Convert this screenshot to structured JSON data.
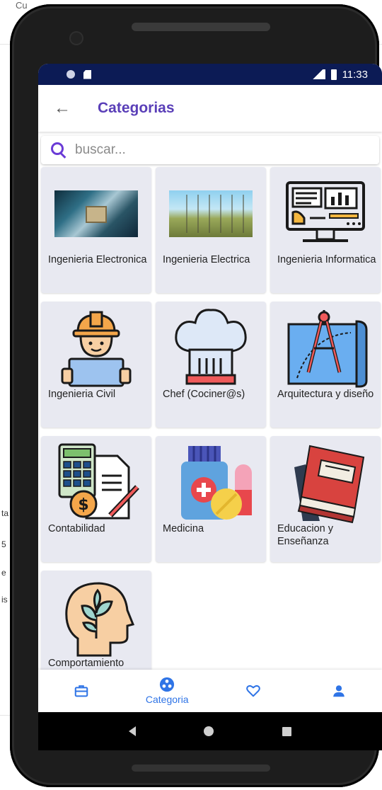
{
  "background": {
    "top_text": "Cu",
    "left_fragments": [
      "ta",
      "5",
      "e",
      "is"
    ]
  },
  "statusbar": {
    "time": "11:33"
  },
  "appbar": {
    "title": "Categorias",
    "back_icon": "arrow-left-icon"
  },
  "search": {
    "placeholder": "buscar...",
    "value": ""
  },
  "categories": [
    {
      "label": "Ingenieria Electronica",
      "icon": "circuit-board-photo"
    },
    {
      "label": "Ingenieria Electrica",
      "icon": "power-lines-photo"
    },
    {
      "label": "Ingenieria Informatica",
      "icon": "computer-dashboard-icon"
    },
    {
      "label": "Ingenieria Civil",
      "icon": "construction-worker-icon"
    },
    {
      "label": "Chef (Cociner@s)",
      "icon": "chef-hat-icon"
    },
    {
      "label": "Arquitectura y diseño",
      "icon": "compass-blueprint-icon"
    },
    {
      "label": "Contabilidad",
      "icon": "calculator-invoice-icon"
    },
    {
      "label": "Medicina",
      "icon": "medicine-bottle-icon"
    },
    {
      "label": "Educacion  y Enseñanza",
      "icon": "books-icon"
    },
    {
      "label": "Comportamiento",
      "icon": "head-plant-icon"
    }
  ],
  "bottomnav": [
    {
      "icon": "briefcase-icon",
      "label": ""
    },
    {
      "icon": "categories-icon",
      "label": "Categoria"
    },
    {
      "icon": "heart-icon",
      "label": ""
    },
    {
      "icon": "person-icon",
      "label": ""
    }
  ],
  "colors": {
    "accent": "#5a3fb8",
    "nav_blue": "#2f74e6",
    "statusbar": "#0c1b55",
    "card_bg": "#e8e9f1"
  }
}
